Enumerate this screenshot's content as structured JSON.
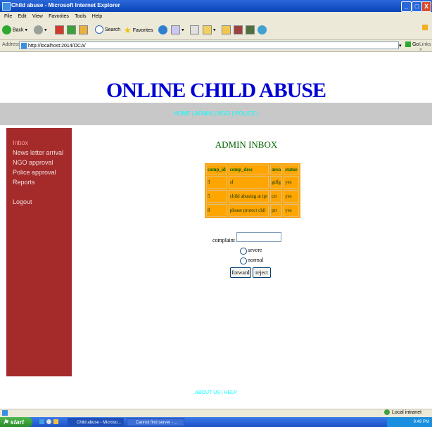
{
  "window": {
    "title": "Child abuse - Microsoft Internet Explorer",
    "minimize": "_",
    "maximize": "□",
    "close": "X"
  },
  "menu": [
    "File",
    "Edit",
    "View",
    "Favorites",
    "Tools",
    "Help"
  ],
  "toolbar": {
    "back": "Back",
    "search": "Search",
    "favorites": "Favorites"
  },
  "address": {
    "label": "Address",
    "url": "http://localhost:2014/OCA/",
    "go": "Go",
    "links": "Links »"
  },
  "site": {
    "title": "ONLINE CHILD ABUSE",
    "nav": "HOME | ADMIN | NGO | POLICE |",
    "footer": "ABOUT US | HELP"
  },
  "sidebar": {
    "items": [
      "Inbox",
      "News letter arrival",
      "NGO approval",
      "Police approval",
      "Reports",
      "Logout"
    ]
  },
  "inbox": {
    "title": "ADMIN INBOX",
    "columns": [
      "comp_id",
      "comp_desc",
      "area",
      "status"
    ],
    "rows": [
      [
        "3",
        "sf",
        "gdfg",
        "yes"
      ],
      [
        "5",
        "child abusing at tpt",
        "ctr",
        "yes"
      ],
      [
        "8",
        "please protect chil",
        "ptr",
        "yes"
      ]
    ]
  },
  "form": {
    "complaint_label": "complaint id:",
    "complaint_value": "",
    "radio_severe": "severe",
    "radio_normal": "normal",
    "forward": "forward",
    "reject": "reject"
  },
  "status": {
    "zone": "Local intranet"
  },
  "taskbar": {
    "start": "start",
    "tasks": [
      "Child abuse - Microso...",
      "Cannot find server - ..."
    ],
    "clock": "9:49 PM"
  },
  "colors": {
    "banner": "#0000d4",
    "sidebar": "#a52a2a",
    "table": "#ffa500",
    "nav_link": "#00ffff"
  }
}
